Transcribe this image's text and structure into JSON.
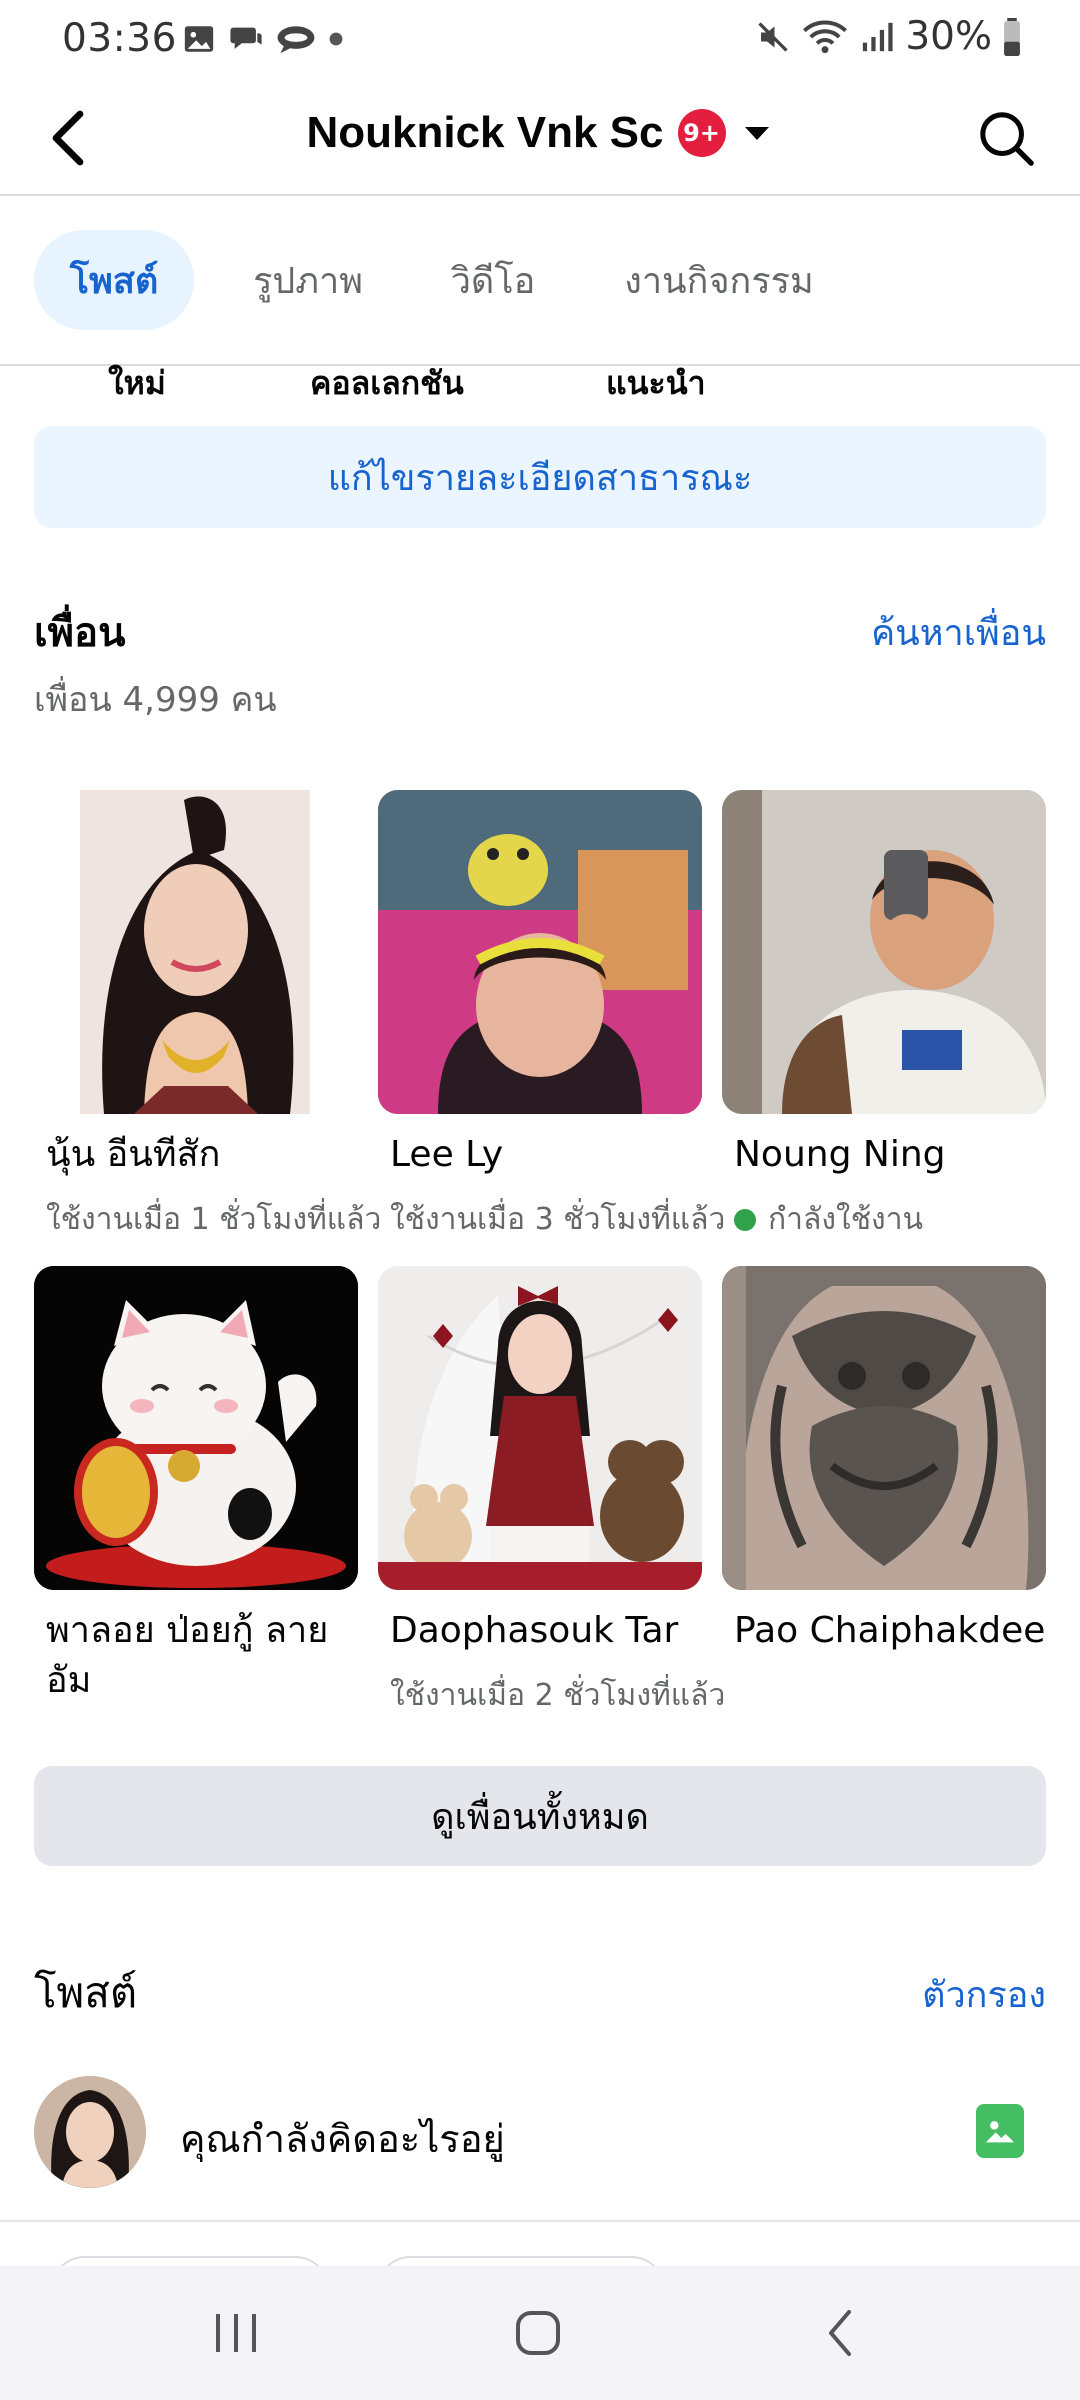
{
  "status_bar": {
    "time": "03:36",
    "battery": "30%"
  },
  "header": {
    "title": "Nouknick Vnk Sc",
    "badge": "9+"
  },
  "tabs": [
    {
      "label": "โพสต์",
      "active": true
    },
    {
      "label": "รูปภาพ",
      "active": false
    },
    {
      "label": "วิดีโอ",
      "active": false
    },
    {
      "label": "งานกิจกรรม",
      "active": false
    }
  ],
  "tab_sub_labels": [
    "ใหม่",
    "คอลเลกชัน",
    "แนะนำ"
  ],
  "edit_details_label": "แก้ไขรายละเอียดสาธารณะ",
  "friends": {
    "title": "เพื่อน",
    "find_link": "ค้นหาเพื่อน",
    "count_text": "เพื่อน 4,999 คน",
    "items": [
      {
        "name": "นุ้น อีนทีสัก",
        "status": "ใช้งานเมื่อ 1 ชั่วโมงที่แล้ว"
      },
      {
        "name": "Lee Ly",
        "status": "ใช้งานเมื่อ 3 ชั่วโมงที่แล้ว"
      },
      {
        "name": "Noung Ning",
        "status": "กำลังใช้งาน"
      },
      {
        "name": "พาลอย ป่อยกู้ ลายอัม",
        "status": ""
      },
      {
        "name": "Daophasouk Tar",
        "status": "ใช้งานเมื่อ 2 ชั่วโมงที่แล้ว"
      },
      {
        "name": "Pao Chaiphakdee",
        "status": ""
      }
    ],
    "see_all_label": "ดูเพื่อนทั้งหมด"
  },
  "posts": {
    "title": "โพสต์",
    "filter_link": "ตัวกรอง",
    "composer_placeholder": "คุณกำลังคิดอะไรอยู่"
  },
  "colors": {
    "accent": "#1763cf",
    "online": "#31a24c",
    "badge": "#e41e3f"
  }
}
